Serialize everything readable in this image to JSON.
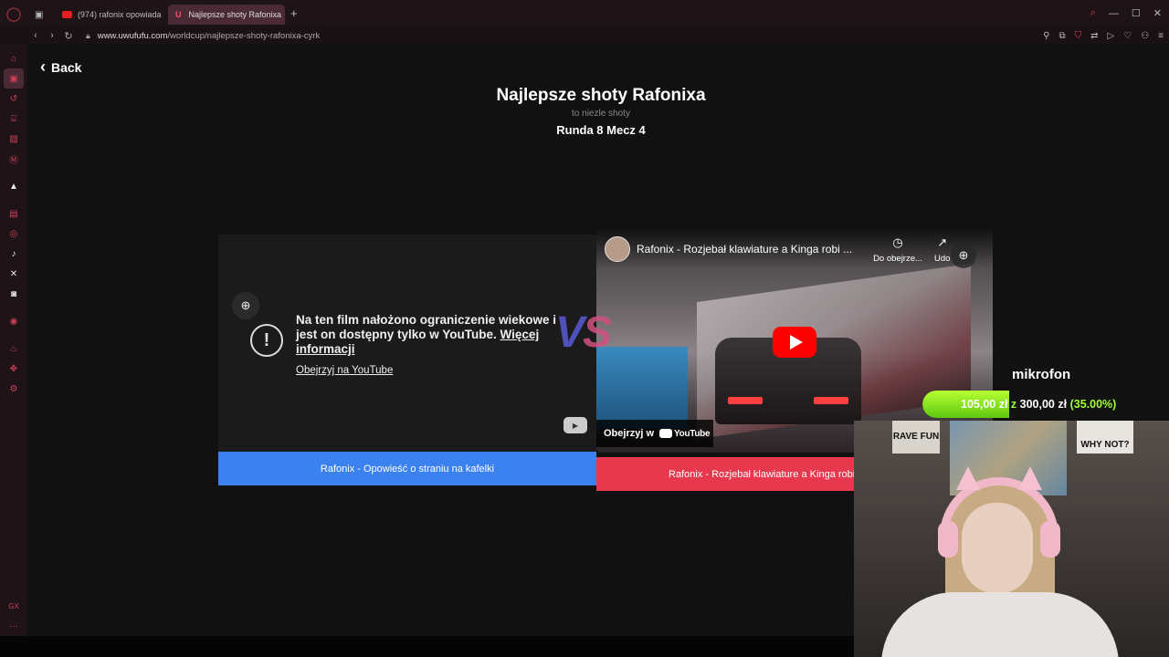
{
  "browser": {
    "tabs": [
      {
        "label": "(974) rafonix opowiada",
        "favicon": "youtube-icon"
      },
      {
        "label": "Najlepsze shoty Rafonixa",
        "favicon": "U"
      }
    ],
    "url_host": "www.uwufufu.com",
    "url_path": "/worldcup/najlepsze-shoty-rafonixa-cyrk"
  },
  "page": {
    "back_label": "Back",
    "title": "Najlepsze shoty Rafonixa",
    "subtitle": "to niezle shoty",
    "round": "Runda 8 Mecz 4",
    "vs_left": "V",
    "vs_right": "S"
  },
  "left_video": {
    "restriction_text": "Na ten film nałożono ograniczenie wiekowe i jest on dostępny tylko w YouTube.",
    "more_info": "Więcej informacji",
    "watch_link": "Obejrzyj na YouTube"
  },
  "right_video": {
    "title": "Rafonix - Rozjebał klawiature a Kinga robi ...",
    "watch_later": "Do obejrze...",
    "share": "Udo",
    "watch_on": "Obejrzyj w",
    "yt_brand": "YouTube"
  },
  "choices": {
    "left": "Rafonix - Opowieść o straniu na kafelki",
    "right": "Rafonix - Rozjebał klawiature a Kinga robi"
  },
  "stream": {
    "label": "mikrofon",
    "amount": "105,00 zł",
    "z": "z",
    "goal": "300,00 zł",
    "percent": "(35.00%)",
    "progress_fraction": 0.35,
    "poster1": "RAVE FUN",
    "poster2": "WHY NOT?"
  },
  "colors": {
    "left_choice": "#3b82f0",
    "right_choice": "#e8384e",
    "accent": "#e0405a"
  }
}
